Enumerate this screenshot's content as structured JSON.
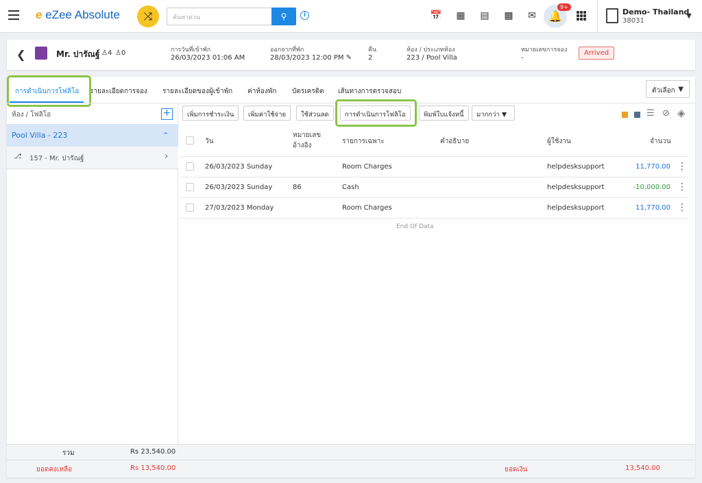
{
  "topbar": {
    "logo": "eZee Absolute",
    "search_placeholder": "ค้นหาด่วน",
    "property": "Demo- Thailand",
    "property_id": "38031",
    "notif_badge": "9+"
  },
  "header": {
    "guest_name": "Mr. ปารัณฐ์",
    "adults": "4",
    "children": "0",
    "checkin_label": "การวันที่เข้าพัก",
    "checkin_value": "26/03/2023 01:06 AM",
    "checkout_label": "ออกจากที่พัก",
    "checkout_value": "28/03/2023 12:00 PM",
    "nights_label": "คืน",
    "nights_value": "2",
    "room_label": "ห้อง / ประเภทห้อง",
    "room_value": "223 / Pool Villa",
    "res_label": "หมายเลขการจอง",
    "res_value": "-",
    "status": "Arrived"
  },
  "tabs": [
    "การดำเนินการโฟลิโอ",
    "รายละเอียดการจอง",
    "รายละเอียดของผู้เข้าพัก",
    "ค่าห้องพัก",
    "บัตรเครดิต",
    "เส้นทางการตรวจสอบ"
  ],
  "options_label": "ตัวเลือก",
  "left": {
    "title": "ห้อง / โฟลิโอ",
    "room": "Pool Villa - 223",
    "guest": "157 - Mr. ปารัณฐ์",
    "total_label": "รวม",
    "total_value": "Rs 23,540.00",
    "balance_label": "ยอดคงเหลือ",
    "balance_value": "Rs 13,540.00"
  },
  "actions": [
    "เพิ่มการชำระเงิน",
    "เพิ่มค่าใช้จ่าย",
    "ใช้ส่วนลด",
    "การดำเนินการโฟลิโอ",
    "พิมพ์ใบแจ้งหนี้",
    "มากกว่า"
  ],
  "columns": {
    "date": "วัน",
    "ref": "หมายเลข อ้างอิง",
    "particular": "รายการเฉพาะ",
    "desc": "คำอธิบาย",
    "user": "ผู้ใช้งาน",
    "amount": "จำนวน"
  },
  "rows": [
    {
      "date": "26/03/2023 Sunday",
      "ref": "",
      "particular": "Room Charges",
      "user": "helpdesksupport",
      "amount": "11,770.00",
      "color": "#1e6fd9"
    },
    {
      "date": "26/03/2023 Sunday",
      "ref": "86",
      "particular": "Cash",
      "user": "helpdesksupport",
      "amount": "-10,000.00",
      "color": "#2e9c3c"
    },
    {
      "date": "27/03/2023 Monday",
      "ref": "",
      "particular": "Room Charges",
      "user": "helpdesksupport",
      "amount": "11,770.00",
      "color": "#1e6fd9"
    }
  ],
  "end_of_data": "End Of Data",
  "footer": {
    "balance_label": "ยอดเงิน",
    "balance_value": "13,540.00"
  },
  "colors": {
    "accent": "#1e88e5",
    "highlight": "#8bc34a",
    "danger": "#e53935"
  }
}
